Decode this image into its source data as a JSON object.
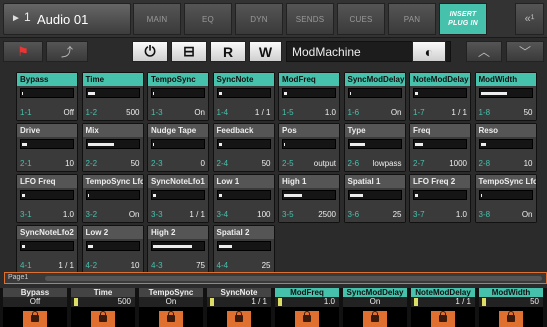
{
  "track": {
    "number": "1",
    "name": "Audio 01"
  },
  "tabs": [
    "MAIN",
    "EQ",
    "DYN",
    "SENDS",
    "CUES",
    "PAN",
    "INSERT PLUG IN"
  ],
  "topright_label": "«¹",
  "bar2": {
    "plugin_name": "ModMachine",
    "slot_indicator": "i1"
  },
  "params": [
    {
      "name": "Bypass",
      "idx": "1-1",
      "value": "Off",
      "fill": 0,
      "teal": true
    },
    {
      "name": "Time",
      "idx": "1-2",
      "value": "500",
      "fill": 0.15,
      "teal": true
    },
    {
      "name": "TempoSync",
      "idx": "1-3",
      "value": "On",
      "fill": 0,
      "teal": true
    },
    {
      "name": "SyncNote",
      "idx": "1-4",
      "value": "1 / 1",
      "fill": 0.02,
      "teal": true
    },
    {
      "name": "ModFreq",
      "idx": "1-5",
      "value": "1.0",
      "fill": 0.02,
      "teal": true
    },
    {
      "name": "SyncModDelay",
      "idx": "1-6",
      "value": "On",
      "fill": 0,
      "teal": true
    },
    {
      "name": "NoteModDelay",
      "idx": "1-7",
      "value": "1 / 1",
      "fill": 0.02,
      "teal": true
    },
    {
      "name": "ModWidth",
      "idx": "1-8",
      "value": "50",
      "fill": 0.5,
      "teal": true
    },
    {
      "name": "Drive",
      "idx": "2-1",
      "value": "10",
      "fill": 0.1,
      "teal": false
    },
    {
      "name": "Mix",
      "idx": "2-2",
      "value": "50",
      "fill": 0.5,
      "teal": false
    },
    {
      "name": "Nudge Tape",
      "idx": "2-3",
      "value": "0",
      "fill": 0,
      "teal": false
    },
    {
      "name": "Feedback",
      "idx": "2-4",
      "value": "50",
      "fill": 0.02,
      "teal": false
    },
    {
      "name": "Pos",
      "idx": "2-5",
      "value": "output",
      "fill": 0,
      "teal": false
    },
    {
      "name": "Type",
      "idx": "2-6",
      "value": "lowpass",
      "fill": 0.3,
      "teal": false
    },
    {
      "name": "Freq",
      "idx": "2-7",
      "value": "1000",
      "fill": 0.15,
      "teal": false
    },
    {
      "name": "Reso",
      "idx": "2-8",
      "value": "10",
      "fill": 0.1,
      "teal": false
    },
    {
      "name": "LFO Freq",
      "idx": "3-1",
      "value": "1.0",
      "fill": 0.02,
      "teal": false
    },
    {
      "name": "TempoSync Lfo1",
      "idx": "3-2",
      "value": "On",
      "fill": 0,
      "teal": false
    },
    {
      "name": "SyncNoteLfo1",
      "idx": "3-3",
      "value": "1 / 1",
      "fill": 0.02,
      "teal": false
    },
    {
      "name": "Low 1",
      "idx": "3-4",
      "value": "100",
      "fill": 0.02,
      "teal": false
    },
    {
      "name": "High 1",
      "idx": "3-5",
      "value": "2500",
      "fill": 0.35,
      "teal": false
    },
    {
      "name": "Spatial 1",
      "idx": "3-6",
      "value": "25",
      "fill": 0.25,
      "teal": false
    },
    {
      "name": "LFO Freq 2",
      "idx": "3-7",
      "value": "1.0",
      "fill": 0.02,
      "teal": false
    },
    {
      "name": "TempoSync Lfo2",
      "idx": "3-8",
      "value": "On",
      "fill": 0,
      "teal": false
    },
    {
      "name": "SyncNoteLfo2",
      "idx": "4-1",
      "value": "1 / 1",
      "fill": 0.02,
      "teal": false
    },
    {
      "name": "Low 2",
      "idx": "4-2",
      "value": "10",
      "fill": 0.1,
      "teal": false
    },
    {
      "name": "High 2",
      "idx": "4-3",
      "value": "75",
      "fill": 0.75,
      "teal": false
    },
    {
      "name": "Spatial 2",
      "idx": "4-4",
      "value": "25",
      "fill": 0.25,
      "teal": false
    }
  ],
  "page_label": "Page1",
  "bottom": [
    {
      "name": "Bypass",
      "value": "Off",
      "bar": false
    },
    {
      "name": "Time",
      "value": "500",
      "bar": true
    },
    {
      "name": "TempoSync",
      "value": "On",
      "bar": false
    },
    {
      "name": "SyncNote",
      "value": "1 / 1",
      "bar": true
    },
    {
      "name": "ModFreq",
      "value": "1.0",
      "bar": true
    },
    {
      "name": "SyncModDelay",
      "value": "On",
      "bar": false
    },
    {
      "name": "NoteModDelay",
      "value": "1 / 1",
      "bar": true
    },
    {
      "name": "ModWidth",
      "value": "50",
      "bar": true
    }
  ],
  "colors": {
    "accent": "#46c1ac",
    "orange": "#e07030",
    "bg": "#2b2b2b"
  }
}
